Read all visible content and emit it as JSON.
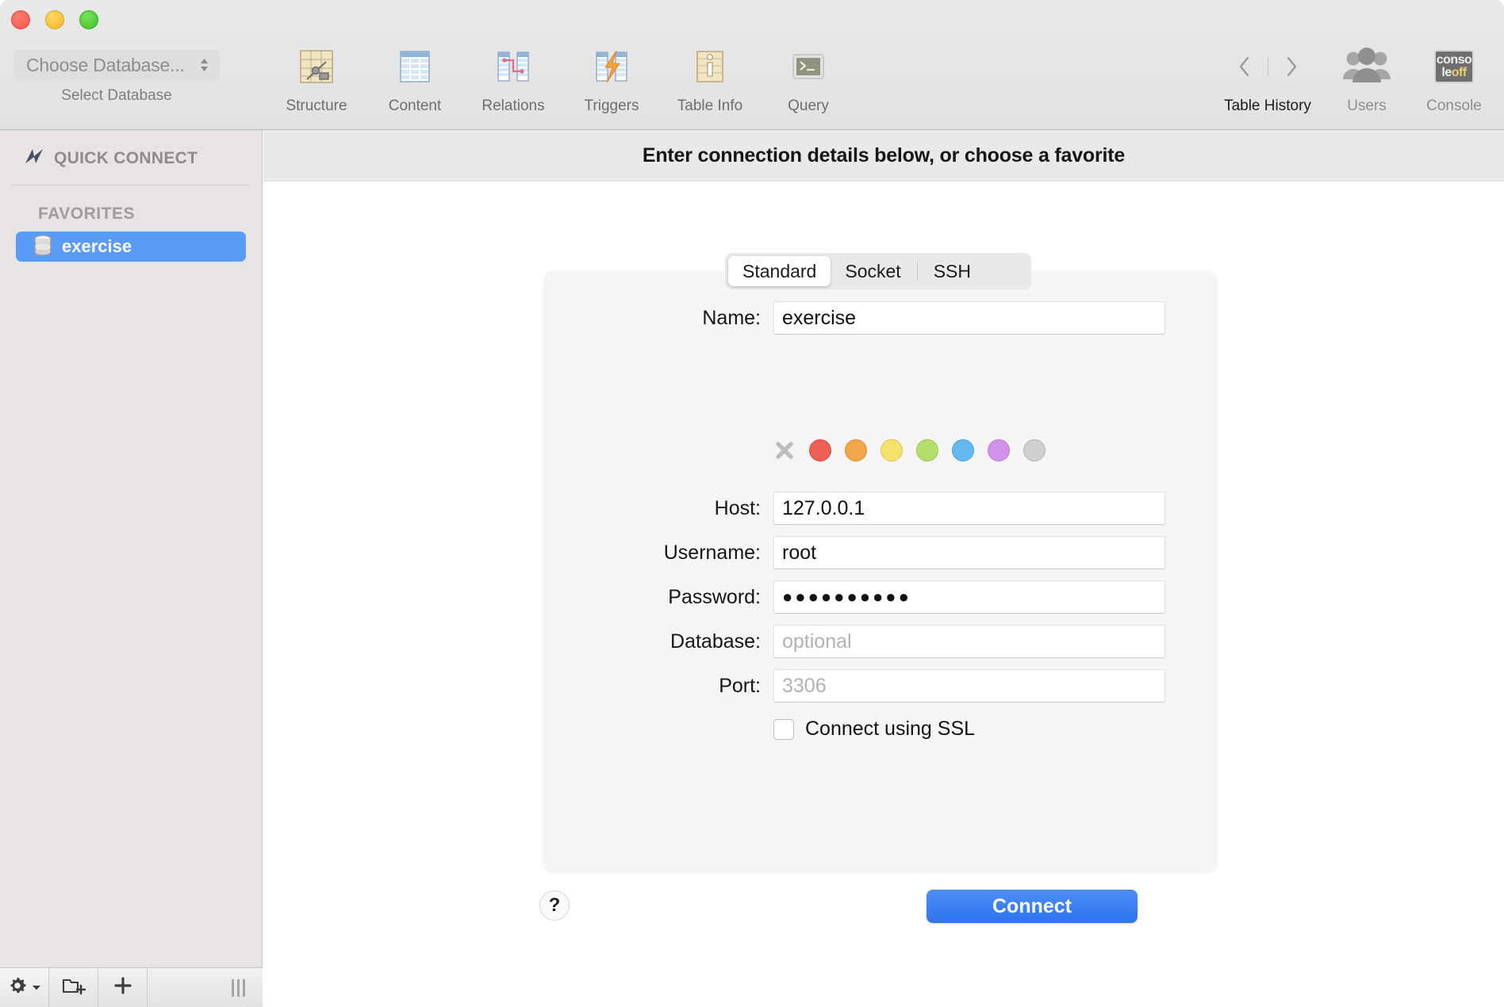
{
  "window": {
    "traffic_lights": [
      "close",
      "minimize",
      "zoom"
    ]
  },
  "toolbar": {
    "database_select": {
      "value": "Choose Database...",
      "caption": "Select Database"
    },
    "items": [
      {
        "label": "Structure",
        "icon": "structure-icon"
      },
      {
        "label": "Content",
        "icon": "content-icon"
      },
      {
        "label": "Relations",
        "icon": "relations-icon"
      },
      {
        "label": "Triggers",
        "icon": "triggers-icon"
      },
      {
        "label": "Table Info",
        "icon": "table-info-icon"
      },
      {
        "label": "Query",
        "icon": "query-icon"
      }
    ],
    "right_items": [
      {
        "label": "Table History",
        "icon": "history-arrows-icon"
      },
      {
        "label": "Users",
        "icon": "users-icon"
      },
      {
        "label": "Console",
        "icon": "console-icon"
      }
    ],
    "console_badge": {
      "line1": "conso",
      "line2a": "le",
      "line2b": "off"
    }
  },
  "sidebar": {
    "quick_connect": {
      "label": "QUICK CONNECT",
      "icon": "lightning-bolt-icon"
    },
    "favorites_header": "FAVORITES",
    "favorites": [
      {
        "name": "exercise",
        "icon": "database-icon",
        "selected": true
      }
    ],
    "bottom_bar": {
      "gear": "gear-icon",
      "new_folder": "new-folder-icon",
      "add": "plus-icon",
      "grip": "resize-grip-icon"
    }
  },
  "main": {
    "banner": "Enter connection details below, or choose a favorite",
    "tabs": [
      {
        "label": "Standard",
        "active": true
      },
      {
        "label": "Socket",
        "active": false
      },
      {
        "label": "SSH",
        "active": false
      }
    ],
    "form": {
      "name": {
        "label": "Name:",
        "value": "exercise",
        "placeholder": ""
      },
      "host": {
        "label": "Host:",
        "value": "127.0.0.1",
        "placeholder": ""
      },
      "username": {
        "label": "Username:",
        "value": "root",
        "placeholder": ""
      },
      "password": {
        "label": "Password:",
        "value": "●●●●●●●●●●",
        "placeholder": ""
      },
      "database": {
        "label": "Database:",
        "value": "",
        "placeholder": "optional"
      },
      "port": {
        "label": "Port:",
        "value": "",
        "placeholder": "3306"
      }
    },
    "color_swatches": {
      "clear_icon": "clear-color-icon",
      "colors": [
        "#ee6055",
        "#f2a649",
        "#f6e36b",
        "#b4de6c",
        "#64b9ef",
        "#d292ea",
        "#cfcfcf"
      ]
    },
    "ssl": {
      "label": "Connect using SSL",
      "checked": false
    },
    "help_button": "?",
    "connect_button": "Connect"
  },
  "theme": {
    "accent": "#3b7ef0",
    "selection": "#5a9bf6",
    "toolbar_bg": "#e6e6e6",
    "sidebar_bg": "#e8e4e4",
    "panel_bg": "#f5f5f5"
  }
}
